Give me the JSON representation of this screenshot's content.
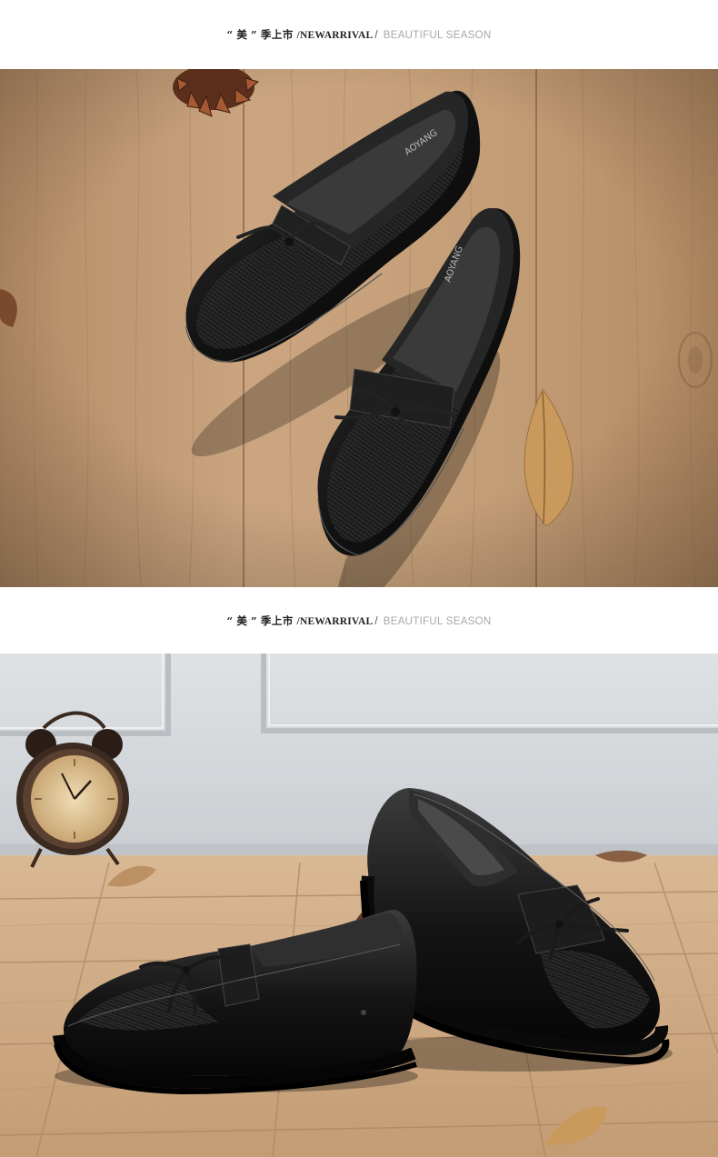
{
  "sections": [
    {
      "title": {
        "quote_open": "“",
        "quoted": "美",
        "quote_close": "”",
        "cn_rest": "季上市",
        "en_bold": "/NEWARRIVAL",
        "separator": "/",
        "en_light": "BEAUTIFUL SEASON"
      },
      "photo": {
        "description_icon": "shoes-on-wood-photo",
        "brand_insole": "AOYANG"
      }
    },
    {
      "title": {
        "quote_open": "“",
        "quoted": "美",
        "quote_close": "”",
        "cn_rest": "季上市",
        "en_bold": "/NEWARRIVAL",
        "separator": "/",
        "en_light": "BEAUTIFUL SEASON"
      },
      "photo": {
        "description_icon": "shoes-with-clock-photo"
      }
    }
  ],
  "colors": {
    "wood_light": "#c7a27c",
    "wood_dark": "#9c7656",
    "floor": "#d8b48c",
    "wall": "#d4d8dc",
    "shoe": "#141414",
    "leaf": "#c99a5c"
  }
}
